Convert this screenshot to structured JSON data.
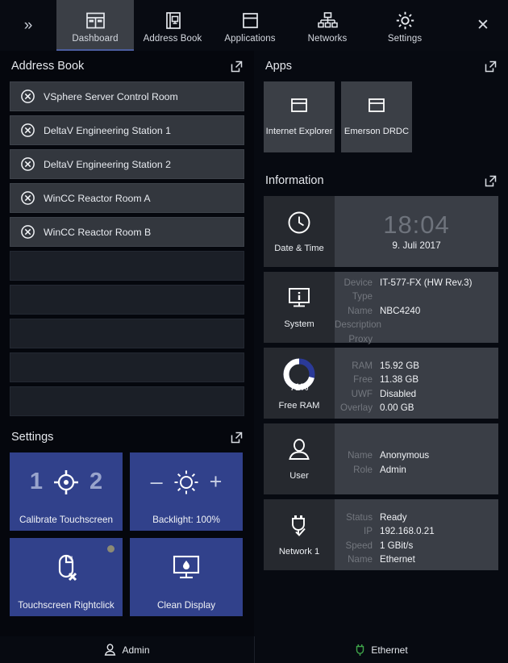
{
  "topnav": {
    "expand_label": "»",
    "close_label": "✕",
    "tabs": [
      {
        "label": "Dashboard",
        "icon": "dashboard-icon",
        "active": true
      },
      {
        "label": "Address Book",
        "icon": "address-book-icon",
        "active": false
      },
      {
        "label": "Applications",
        "icon": "window-icon",
        "active": false
      },
      {
        "label": "Networks",
        "icon": "network-tree-icon",
        "active": false
      },
      {
        "label": "Settings",
        "icon": "gear-icon",
        "active": false
      }
    ]
  },
  "address_book": {
    "title": "Address Book",
    "entries": [
      "VSphere Server Control Room",
      "DeltaV Engineering Station 1",
      "DeltaV Engineering Station 2",
      "WinCC Reactor Room A",
      "WinCC Reactor Room B"
    ],
    "empty_rows": 5
  },
  "settings": {
    "title": "Settings",
    "tiles": [
      {
        "label": "Calibrate Touchscreen",
        "icon": "crosshair-icon",
        "left_text": "1",
        "right_text": "2",
        "dot": false
      },
      {
        "label": "Backlight: 100%",
        "icon": "brightness-icon",
        "left_text": "–",
        "right_text": "+",
        "dot": false
      },
      {
        "label": "Touchscreen Rightclick",
        "icon": "mouse-x-icon",
        "left_text": "",
        "right_text": "",
        "dot": true
      },
      {
        "label": "Clean Display",
        "icon": "clean-display-icon",
        "left_text": "",
        "right_text": "",
        "dot": false
      }
    ]
  },
  "apps": {
    "title": "Apps",
    "items": [
      {
        "label": "Internet Explorer",
        "icon": "window-icon"
      },
      {
        "label": "Emerson DRDC",
        "icon": "window-icon"
      }
    ]
  },
  "information": {
    "title": "Information",
    "datetime": {
      "label": "Date & Time",
      "icon": "clock-icon",
      "time": "18:04",
      "date": "9. Juli 2017"
    },
    "system": {
      "label": "System",
      "icon": "monitor-info-icon",
      "rows": [
        {
          "key": "Device Type",
          "value": "IT-577-FX (HW Rev.3)"
        },
        {
          "key": "Name",
          "value": "NBC4240"
        },
        {
          "key": "Description",
          "value": ""
        },
        {
          "key": "Proxy",
          "value": ""
        }
      ]
    },
    "ram": {
      "label": "Free RAM",
      "icon": "donut-gauge-icon",
      "percent": "71%",
      "percent_value": 71,
      "ring_color": "#2b3a99",
      "arc_color": "#ffffff",
      "rows": [
        {
          "key": "RAM",
          "value": "15.92 GB"
        },
        {
          "key": "Free",
          "value": "11.38 GB"
        },
        {
          "key": "UWF",
          "value": "Disabled"
        },
        {
          "key": "Overlay",
          "value": "0.00 GB"
        }
      ]
    },
    "user": {
      "label": "User",
      "icon": "user-icon",
      "rows": [
        {
          "key": "Name",
          "value": "Anonymous"
        },
        {
          "key": "Role",
          "value": "Admin"
        }
      ]
    },
    "network": {
      "label": "Network 1",
      "icon": "network-plug-check-icon",
      "rows": [
        {
          "key": "Status",
          "value": "Ready"
        },
        {
          "key": "IP",
          "value": "192.168.0.21"
        },
        {
          "key": "Speed",
          "value": "1 GBit/s"
        },
        {
          "key": "Name",
          "value": "Ethernet"
        }
      ]
    }
  },
  "footer": {
    "user_label": "Admin",
    "network_label": "Ethernet",
    "network_color": "#3fa64a"
  }
}
